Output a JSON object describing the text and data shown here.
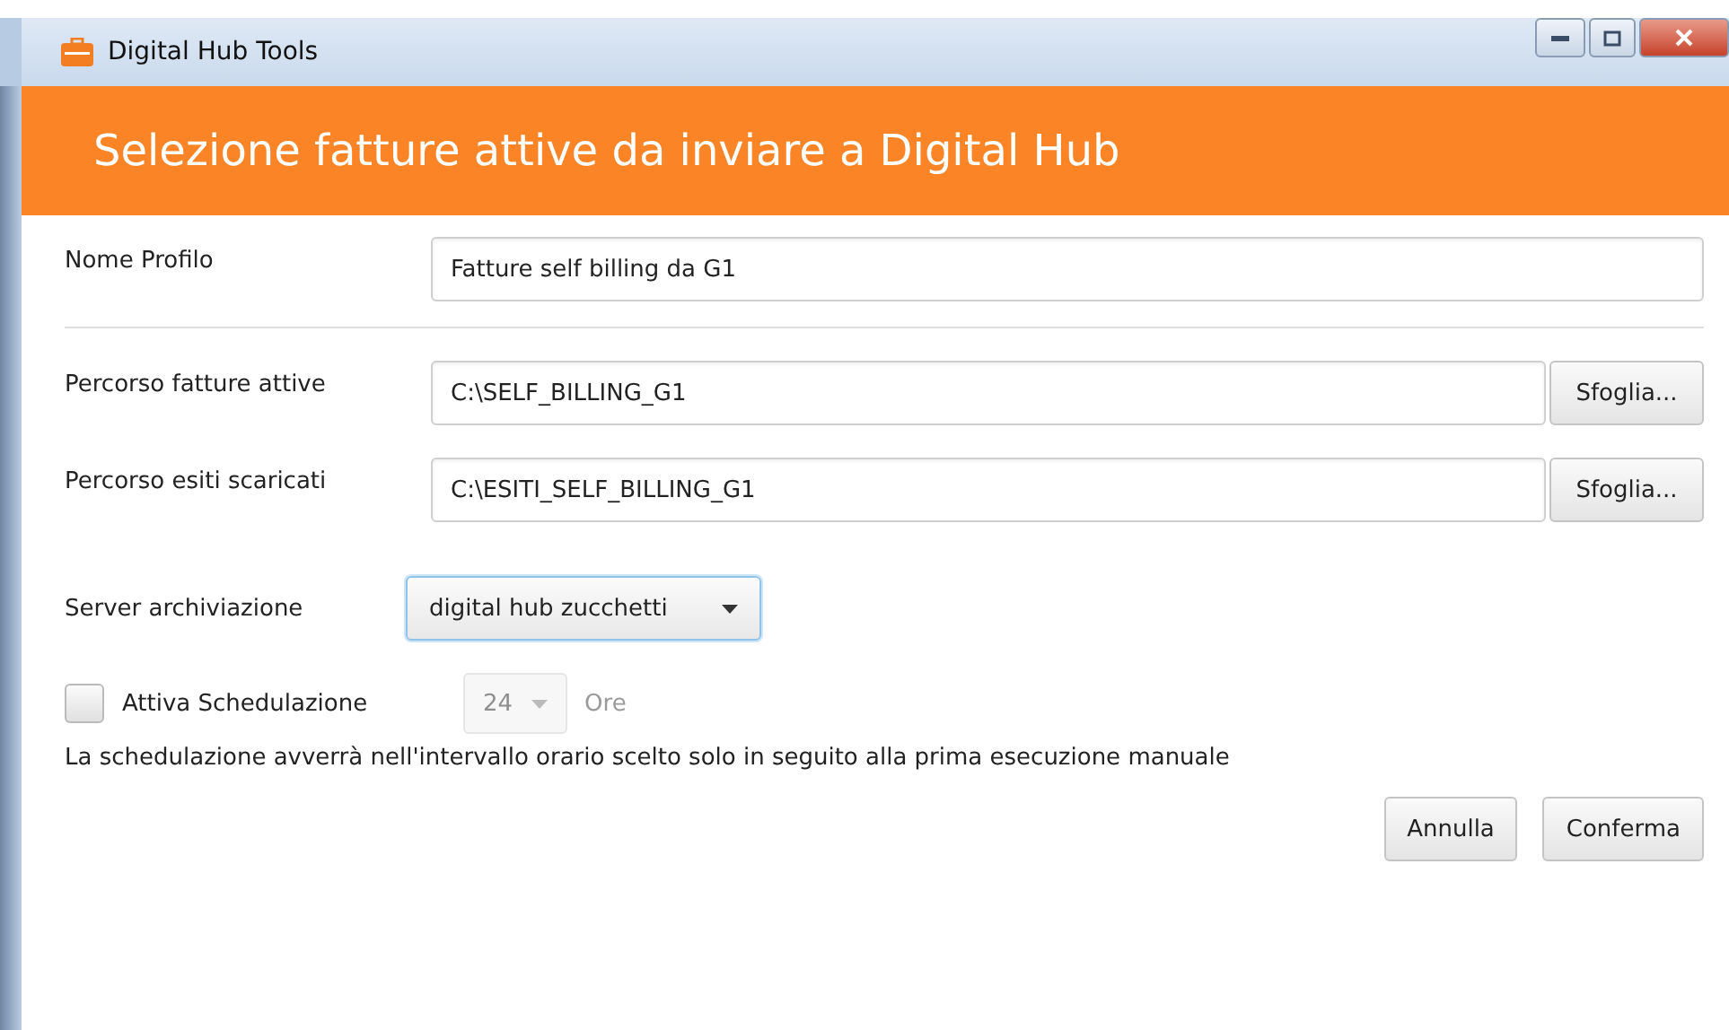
{
  "window": {
    "title": "Digital Hub Tools"
  },
  "header": {
    "title": "Selezione fatture attive da inviare a Digital Hub"
  },
  "profile": {
    "label": "Nome Profilo",
    "value": "Fatture self billing da G1"
  },
  "paths": [
    {
      "label": "Percorso fatture attive",
      "value": "C:\\SELF_BILLING_G1",
      "button": "Sfoglia..."
    },
    {
      "label": "Percorso esiti scaricati",
      "value": "C:\\ESITI_SELF_BILLING_G1",
      "button": "Sfoglia..."
    }
  ],
  "server": {
    "label": "Server archiviazione",
    "value": "digital hub zucchetti"
  },
  "schedule": {
    "label": "Attiva Schedulazione",
    "checked": false,
    "hours": "24",
    "unit": "Ore",
    "disabled": true
  },
  "note": "La schedulazione avverrà nell'intervallo orario scelto solo in seguito alla prima esecuzione manuale",
  "buttons": [
    "Annulla",
    "Conferma"
  ]
}
